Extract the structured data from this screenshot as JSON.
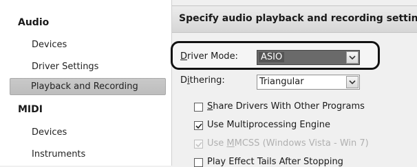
{
  "sidebar": {
    "categories": [
      {
        "label": "Audio",
        "items": [
          "Devices",
          "Driver Settings",
          "Playback and Recording"
        ]
      },
      {
        "label": "MIDI",
        "items": [
          "Devices",
          "Instruments"
        ]
      }
    ],
    "selected": "Playback and Recording"
  },
  "main": {
    "header": "Specify audio playback and recording settings.",
    "driver_mode": {
      "label_accel": "D",
      "label_rest": "river Mode:",
      "value": "ASIO"
    },
    "dithering": {
      "label_pre": "D",
      "label_accel": "i",
      "label_rest": "thering:",
      "value": "Triangular"
    },
    "options": [
      {
        "pre": "",
        "accel": "S",
        "rest": "hare Drivers With Other Programs",
        "checked": false,
        "enabled": true
      },
      {
        "pre": "Use Multiprocessing Engine",
        "accel": "",
        "rest": "",
        "checked": true,
        "enabled": true
      },
      {
        "pre": "Use ",
        "accel": "M",
        "rest": "MCSS (Windows Vista - Win 7)",
        "checked": true,
        "enabled": false
      },
      {
        "pre": "Play Effect Tails After Stopping",
        "accel": "",
        "rest": "",
        "checked": false,
        "enabled": true
      }
    ]
  },
  "colors": {
    "selection_bg": "#c4c4c4",
    "highlight_ring": "#111111",
    "disabled_text": "#b0b0b0"
  }
}
